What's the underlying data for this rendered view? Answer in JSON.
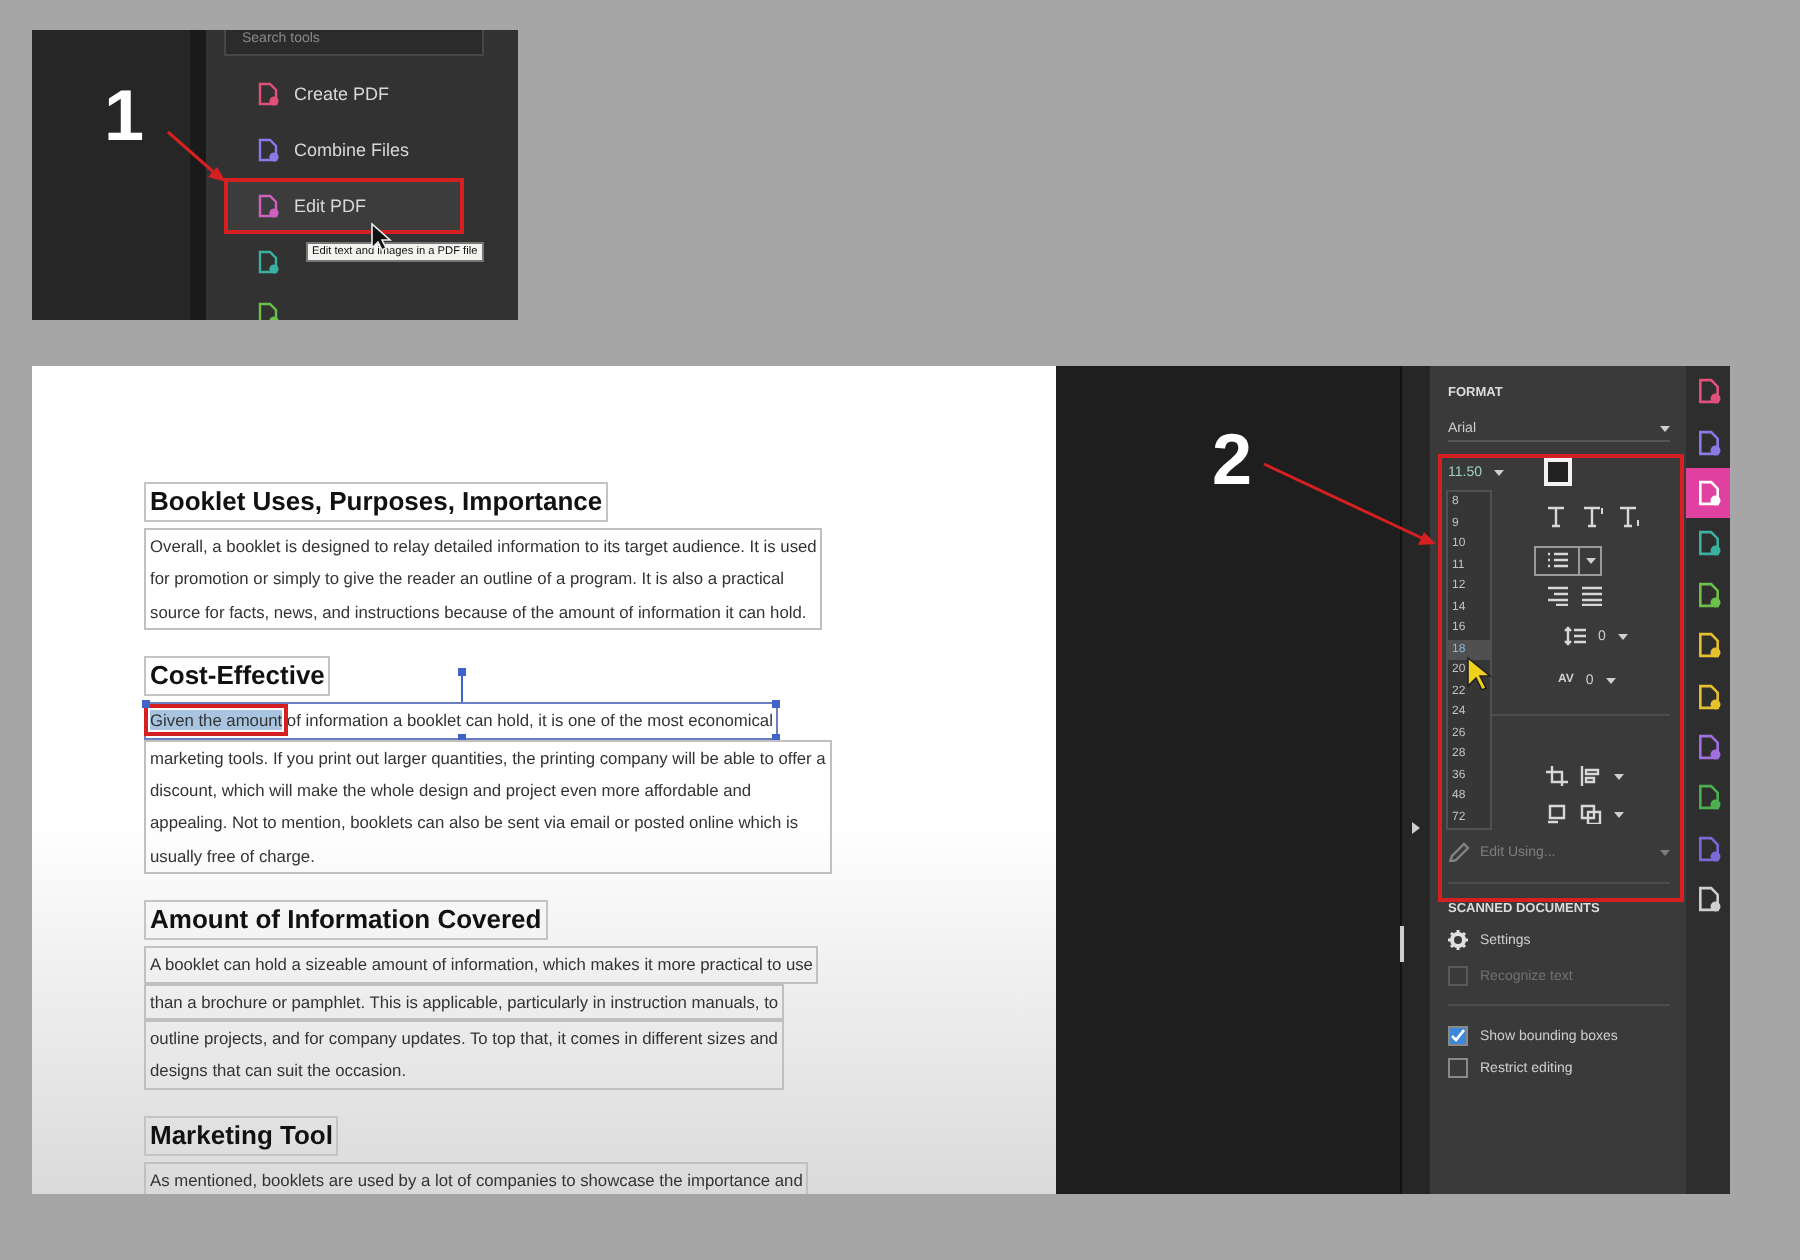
{
  "annotations": [
    "1",
    "2"
  ],
  "tools_panel": {
    "search_placeholder": "Search tools",
    "items": [
      {
        "label": "Create PDF",
        "selected": false
      },
      {
        "label": "Combine Files",
        "selected": false
      },
      {
        "label": "Edit PDF",
        "selected": true
      }
    ],
    "tooltip": "Edit text and images in a PDF file"
  },
  "document": {
    "sections": [
      {
        "heading": "Booklet Uses, Purposes, Importance",
        "blocks": [
          {
            "selected": false,
            "lines": [
              "Overall, a booklet is designed to relay detailed information to its target audience. It is used",
              "for promotion or simply to give the reader an outline of a program. It is also a practical",
              "source for facts, news, and instructions because of the amount of information it can hold."
            ]
          }
        ]
      },
      {
        "heading": "Cost-Effective",
        "blocks": [
          {
            "selected": true,
            "lead": "Given the amount",
            "lines": [
              " of information a booklet can hold, it is one of the most economical"
            ]
          },
          {
            "selected": false,
            "lines": [
              "marketing tools. If you print out larger quantities, the printing company will be able to offer a",
              "discount, which will make the whole design and project even more affordable and",
              "appealing. Not to mention, booklets can also be sent via email or posted online which is",
              "usually free of charge."
            ]
          }
        ]
      },
      {
        "heading": "Amount of Information Covered",
        "blocks": [
          {
            "selected": false,
            "lines": [
              "A booklet can hold a sizeable amount of information, which makes it more practical to use"
            ]
          },
          {
            "selected": false,
            "lines": [
              "than a brochure or pamphlet. This is applicable, particularly in instruction manuals, to"
            ]
          },
          {
            "selected": false,
            "lines": [
              "outline projects, and for company updates. To top that, it comes in different sizes and",
              "designs that can suit the occasion."
            ]
          }
        ]
      },
      {
        "heading": "Marketing Tool",
        "blocks": [
          {
            "selected": false,
            "lines": [
              "As mentioned, booklets are used by a lot of companies to showcase the importance and"
            ]
          }
        ]
      }
    ]
  },
  "format_panel": {
    "title": "FORMAT",
    "font": "Arial",
    "font_size": "11.50",
    "size_options": [
      {
        "label": "8",
        "selected": false
      },
      {
        "label": "9",
        "selected": false
      },
      {
        "label": "10",
        "selected": false
      },
      {
        "label": "11",
        "selected": false
      },
      {
        "label": "12",
        "selected": false
      },
      {
        "label": "14",
        "selected": false
      },
      {
        "label": "16",
        "selected": false
      },
      {
        "label": "18",
        "selected": true
      },
      {
        "label": "20",
        "selected": false
      },
      {
        "label": "22",
        "selected": false
      },
      {
        "label": "24",
        "selected": false
      },
      {
        "label": "26",
        "selected": false
      },
      {
        "label": "28",
        "selected": false
      },
      {
        "label": "36",
        "selected": false
      },
      {
        "label": "48",
        "selected": false
      },
      {
        "label": "72",
        "selected": false
      }
    ],
    "line_spacing": "0",
    "char_spacing_label": "AV",
    "char_spacing": "0",
    "edit_using": {
      "label": "Edit Using...",
      "disabled": true
    }
  },
  "scanned_documents": {
    "title": "SCANNED DOCUMENTS",
    "settings": "Settings",
    "options": [
      {
        "label": "Recognize text",
        "checked": false,
        "disabled": true
      },
      {
        "label": "Show bounding boxes",
        "checked": true,
        "disabled": false
      },
      {
        "label": "Restrict editing",
        "checked": false,
        "disabled": false
      }
    ]
  },
  "tool_rail": [
    {
      "selected": false
    },
    {
      "selected": false
    },
    {
      "selected": true
    },
    {
      "selected": false
    },
    {
      "selected": false
    },
    {
      "selected": false
    },
    {
      "selected": false
    },
    {
      "selected": false
    },
    {
      "selected": false
    },
    {
      "selected": false
    },
    {
      "selected": false
    }
  ]
}
